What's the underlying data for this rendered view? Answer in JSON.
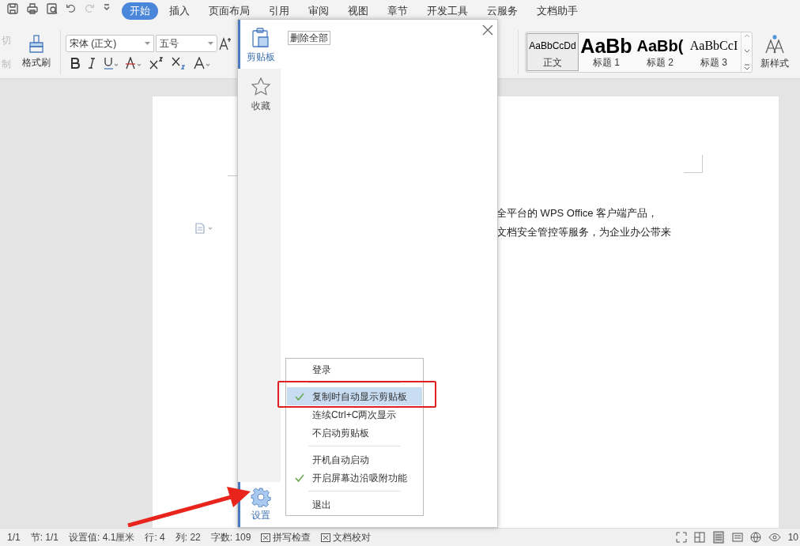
{
  "tabs": [
    {
      "label": "开始",
      "selected": true
    },
    {
      "label": "插入",
      "selected": false
    },
    {
      "label": "页面布局",
      "selected": false
    },
    {
      "label": "引用",
      "selected": false
    },
    {
      "label": "审阅",
      "selected": false
    },
    {
      "label": "视图",
      "selected": false
    },
    {
      "label": "章节",
      "selected": false
    },
    {
      "label": "开发工具",
      "selected": false
    },
    {
      "label": "云服务",
      "selected": false
    },
    {
      "label": "文档助手",
      "selected": false
    }
  ],
  "ribbon": {
    "cut_label": "切",
    "copy_label": "制",
    "format_painter": "格式刷",
    "font_name": "宋体 (正文)",
    "font_size": "五号",
    "styles": [
      {
        "kind": "normal",
        "preview": "AaBbCcDd",
        "label": "正文",
        "selected": true
      },
      {
        "kind": "heading1",
        "preview": "AaBb",
        "label": "标题 1",
        "selected": false
      },
      {
        "kind": "heading2",
        "preview": "AaBb(",
        "label": "标题 2",
        "selected": false
      },
      {
        "kind": "heading3",
        "preview": "AaBbCcI",
        "label": "标题 3",
        "selected": false
      }
    ],
    "new_style": "新样式"
  },
  "document": {
    "lines": [
      "全平台的 WPS Office 客户端产品，",
      "文档安全管控等服务，为企业办公带来"
    ]
  },
  "clipboard_panel": {
    "sidebar": [
      {
        "label": "剪贴板",
        "selected": true
      },
      {
        "label": "收藏",
        "selected": false
      }
    ],
    "delete_all": "删除全部",
    "settings": {
      "label": "设置",
      "selected": true
    }
  },
  "settings_menu": [
    {
      "kind": "item",
      "label": "登录",
      "checked": false,
      "selected": false
    },
    {
      "kind": "separator"
    },
    {
      "kind": "item",
      "label": "复制时自动显示剪贴板",
      "checked": true,
      "selected": true
    },
    {
      "kind": "item",
      "label": "连续Ctrl+C两次显示",
      "checked": false,
      "selected": false
    },
    {
      "kind": "item",
      "label": "不启动剪贴板",
      "checked": false,
      "selected": false
    },
    {
      "kind": "separator"
    },
    {
      "kind": "item",
      "label": "开机自动启动",
      "checked": false,
      "selected": false
    },
    {
      "kind": "item",
      "label": "开启屏幕边沿吸附功能",
      "checked": true,
      "selected": false
    },
    {
      "kind": "separator"
    },
    {
      "kind": "item",
      "label": "退出",
      "checked": false,
      "selected": false
    }
  ],
  "status_bar": {
    "items": [
      {
        "kind": "text",
        "label": "1/1"
      },
      {
        "kind": "text",
        "label": "节: 1/1"
      },
      {
        "kind": "text",
        "label": "设置值: 4.1厘米"
      },
      {
        "kind": "text",
        "label": "行: 4"
      },
      {
        "kind": "text",
        "label": "列: 22"
      },
      {
        "kind": "text",
        "label": "字数: 109"
      },
      {
        "kind": "toggle",
        "label": "拼写检查"
      },
      {
        "kind": "toggle",
        "label": "文档校对"
      }
    ],
    "zoom": "10"
  }
}
